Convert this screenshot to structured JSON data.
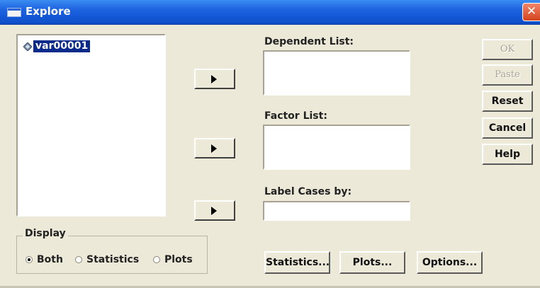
{
  "window": {
    "title": "Explore"
  },
  "variables": [
    "var00001"
  ],
  "fields": {
    "dependent_label": "Dependent List:",
    "factor_label": "Factor List:",
    "labelcases_label": "Label Cases by:"
  },
  "buttons": {
    "ok": "OK",
    "paste": "Paste",
    "reset": "Reset",
    "cancel": "Cancel",
    "help": "Help",
    "statistics": "Statistics...",
    "plots": "Plots...",
    "options": "Options..."
  },
  "display": {
    "title": "Display",
    "options": [
      "Both",
      "Statistics",
      "Plots"
    ],
    "selected": "Both"
  },
  "colors": {
    "titlebar": "#1d63e0",
    "selection": "#0a2a8c",
    "face": "#ece9d8"
  }
}
